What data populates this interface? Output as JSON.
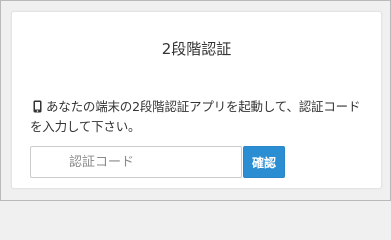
{
  "dialog": {
    "title": "2段階認証",
    "message": "あなたの端末の2段階認証アプリを起動して、認証コードを入力して下さい。",
    "icon": "mobile-phone-icon"
  },
  "code_input": {
    "value": "",
    "placeholder": "認証コード"
  },
  "confirm_button": {
    "label": "確認",
    "color": "#2b8ed3"
  }
}
